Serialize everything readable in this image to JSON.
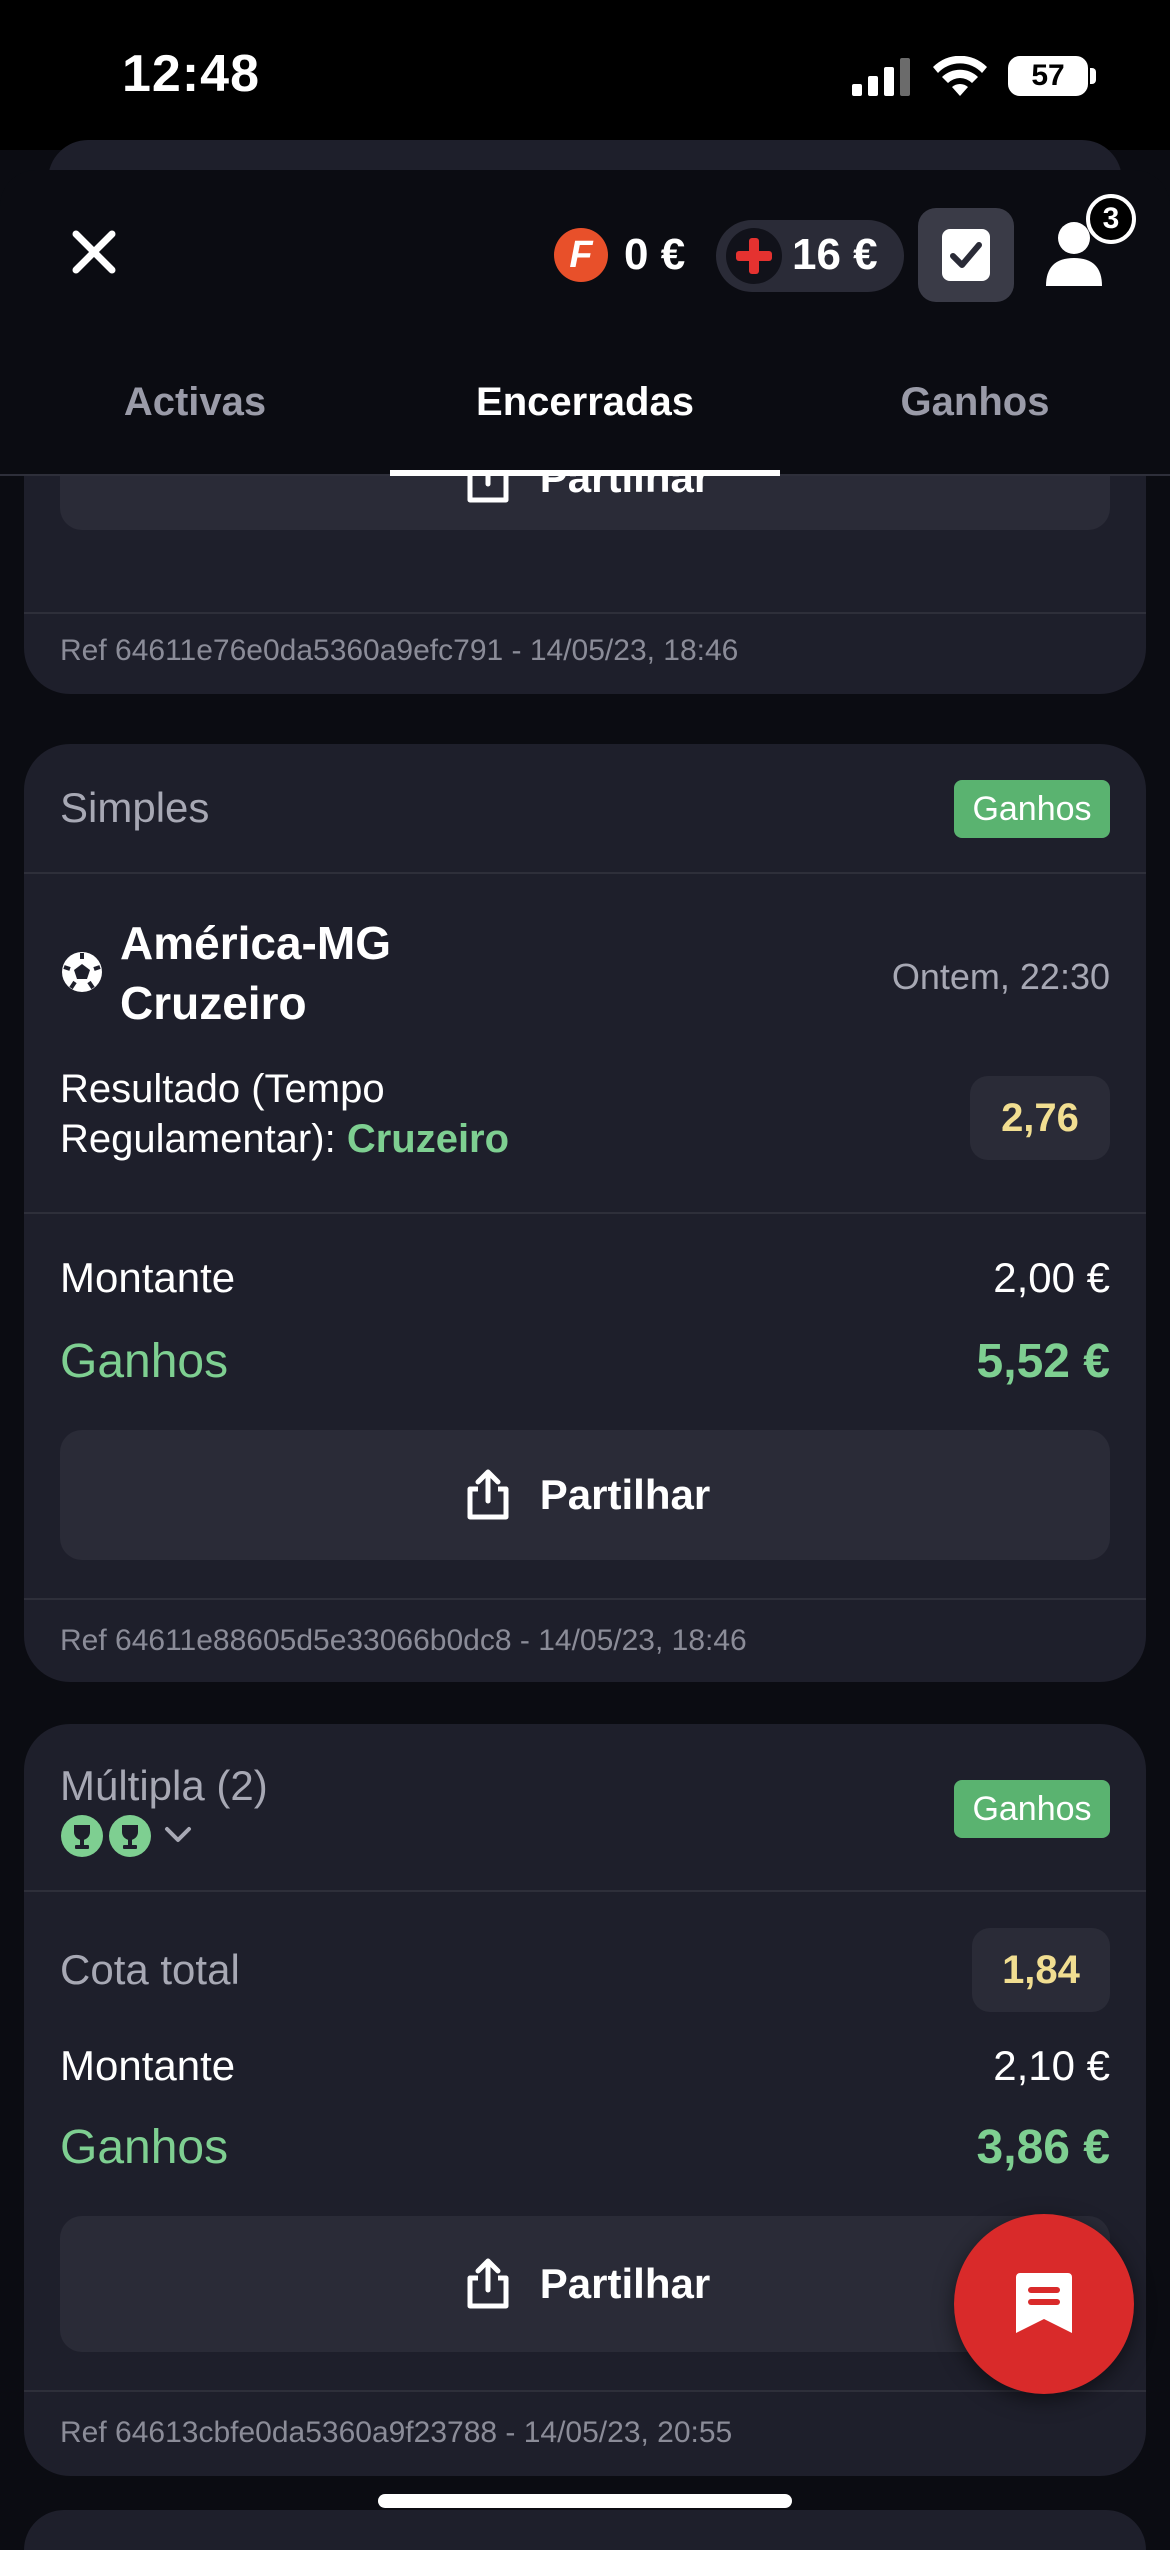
{
  "status_bar": {
    "time": "12:48",
    "battery": "57"
  },
  "header": {
    "bonus_value": "0 €",
    "bonus_icon_letter": "F",
    "balance_value": "16 €",
    "notifications_count": "3"
  },
  "tabs": [
    {
      "label": "Activas",
      "selected": false
    },
    {
      "label": "Encerradas",
      "selected": true
    },
    {
      "label": "Ganhos",
      "selected": false
    }
  ],
  "bets": [
    {
      "share_label": "Partilhar",
      "ref": "Ref 64611e76e0da5360a9efc791 - 14/05/23, 18:46"
    },
    {
      "type": "Simples",
      "status": "Ganhos",
      "team_home": "América-MG",
      "team_away": "Cruzeiro",
      "datetime": "Ontem, 22:30",
      "market": "Resultado (Tempo Regulamentar):",
      "selection": "Cruzeiro",
      "odds": "2,76",
      "amount_label": "Montante",
      "amount": "2,00 €",
      "winnings_label": "Ganhos",
      "winnings": "5,52 €",
      "share_label": "Partilhar",
      "ref": "Ref 64611e88605d5e33066b0dc8 - 14/05/23, 18:46"
    },
    {
      "type": "Múltipla (2)",
      "status": "Ganhos",
      "total_odds_label": "Cota total",
      "total_odds": "1,84",
      "amount_label": "Montante",
      "amount": "2,10 €",
      "winnings_label": "Ganhos",
      "winnings": "3,86 €",
      "share_label": "Partilhar",
      "ref": "Ref 64613cbfe0da5360a9f23788 - 14/05/23, 20:55"
    }
  ],
  "colors": {
    "accent_red": "#d92a2a",
    "win_green": "#5ab370",
    "odds_yellow": "#f1de91"
  }
}
